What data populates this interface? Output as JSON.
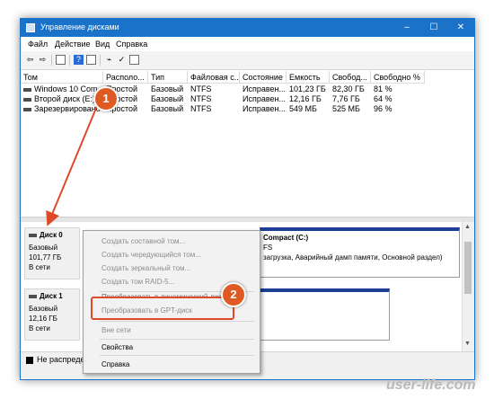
{
  "window": {
    "title": "Управление дисками",
    "controls": {
      "minimize": "–",
      "maximize": "☐",
      "close": "✕"
    }
  },
  "menu": [
    "Файл",
    "Действие",
    "Вид",
    "Справка"
  ],
  "toolbar_icons": [
    "back-arrow-icon",
    "forward-arrow-icon",
    "panel-icon",
    "help-icon",
    "properties-icon",
    "connect-icon",
    "checklist-icon",
    "view-icon"
  ],
  "columns": [
    "Том",
    "Располо...",
    "Тип",
    "Файловая с...",
    "Состояние",
    "Емкость",
    "Свобод...",
    "Свободно %"
  ],
  "volumes": [
    {
      "name": "Windows 10 Com",
      "layout": "Простой",
      "type": "Базовый",
      "fs": "NTFS",
      "status": "Исправен...",
      "capacity": "101,23 ГБ",
      "free": "82,30 ГБ",
      "free_pct": "81 %"
    },
    {
      "name": "Второй диск (E:)",
      "layout": "Простой",
      "type": "Базовый",
      "fs": "NTFS",
      "status": "Исправен...",
      "capacity": "12,16 ГБ",
      "free": "7,76 ГБ",
      "free_pct": "64 %"
    },
    {
      "name": "Зарезервировано",
      "layout": "Простой",
      "type": "Базовый",
      "fs": "NTFS",
      "status": "Исправен...",
      "capacity": "549 МБ",
      "free": "525 МБ",
      "free_pct": "96 %"
    }
  ],
  "disks": [
    {
      "name": "Диск 0",
      "type": "Базовый",
      "size": "101,77 ГБ",
      "status": "В сети"
    },
    {
      "name": "Диск 1",
      "type": "Базовый",
      "size": "12,16 ГБ",
      "status": "В сети"
    }
  ],
  "partition_c": {
    "title": "Compact  (C:)",
    "line2": "FS",
    "line3": "загрузка, Аварийный дамп памяти, Основной раздел)"
  },
  "legend": {
    "unallocated": "Не распредел"
  },
  "context_menu": {
    "items_disabled": [
      "Создать составной том...",
      "Создать чередующийся том...",
      "Создать зеркальный том...",
      "Создать том RAID-5..."
    ],
    "convert_dynamic": "Преобразовать в динамический диск...",
    "convert_gpt": "Преобразовать в GPT-диск",
    "offline": "Вне сети",
    "properties": "Свойства",
    "help": "Справка"
  },
  "annotations": {
    "badge1": "1",
    "badge2": "2"
  },
  "watermark": "user-life.com",
  "colors": {
    "title_bar": "#1a73c9",
    "partition_header": "#1c3f95",
    "badge": "#de5a22",
    "highlight": "#e04a2a"
  }
}
